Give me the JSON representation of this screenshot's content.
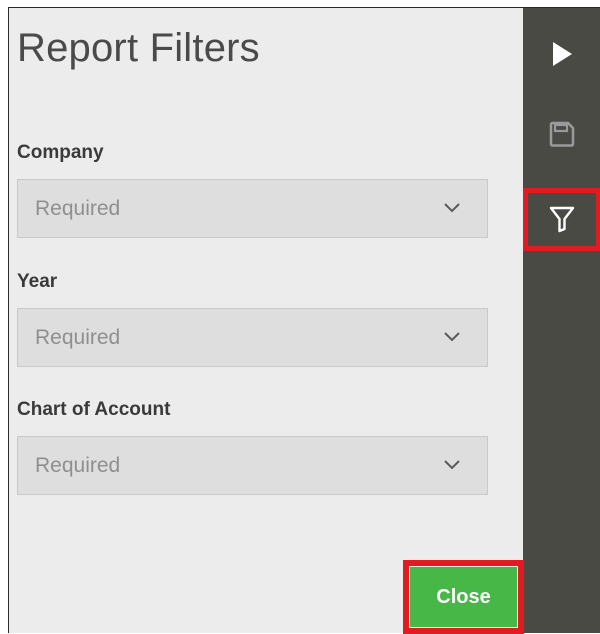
{
  "panel": {
    "title": "Report Filters"
  },
  "filters": [
    {
      "label": "Company",
      "value": "Required"
    },
    {
      "label": "Year",
      "value": "Required"
    },
    {
      "label": "Chart of Account",
      "value": "Required"
    }
  ],
  "sidebar": {
    "buttons": [
      {
        "icon": "play-icon"
      },
      {
        "icon": "save-icon"
      },
      {
        "icon": "filter-icon",
        "highlighted": true
      }
    ]
  },
  "footer": {
    "close_label": "Close"
  },
  "colors": {
    "panel_bg": "#ececec",
    "sidebar_bg": "#4a4a44",
    "select_bg": "#dedede",
    "close_green": "#47b848",
    "highlight_red": "#e01b22"
  }
}
